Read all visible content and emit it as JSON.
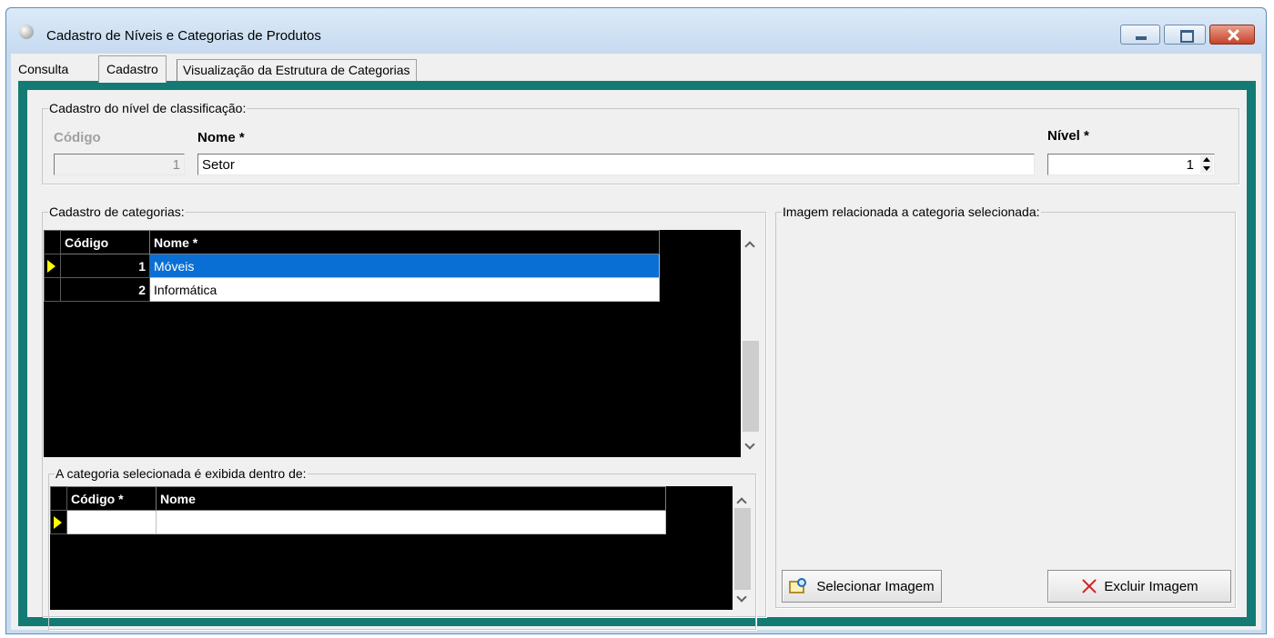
{
  "window": {
    "title": "Cadastro de Níveis e Categorias de Produtos"
  },
  "tabs": [
    {
      "label": "Consulta"
    },
    {
      "label": "Cadastro"
    },
    {
      "label": "Visualização da Estrutura de Categorias"
    }
  ],
  "nivel": {
    "legend": "Cadastro do nível de classificação:",
    "codigo_label": "Código",
    "codigo_value": "1",
    "nome_label": "Nome *",
    "nome_value": "Setor",
    "nivel_label": "Nível *",
    "nivel_value": "1"
  },
  "categorias": {
    "legend": "Cadastro de categorias:",
    "columns": [
      "Código",
      "Nome *"
    ],
    "rows": [
      {
        "codigo": "1",
        "nome": "Móveis",
        "selected": true
      },
      {
        "codigo": "2",
        "nome": "Informática",
        "selected": false
      }
    ]
  },
  "parent": {
    "legend": "A categoria selecionada é exibida dentro de:",
    "columns": [
      "Código *",
      "Nome"
    ],
    "rows": [
      {
        "codigo": "",
        "nome": ""
      }
    ]
  },
  "imagem": {
    "legend": "Imagem relacionada a categoria selecionada:",
    "select_label": "Selecionar Imagem",
    "delete_label": "Excluir Imagem"
  },
  "colors": {
    "frame": "#137a74",
    "selection": "#0a6fd4",
    "indicator": "#ffff00"
  }
}
